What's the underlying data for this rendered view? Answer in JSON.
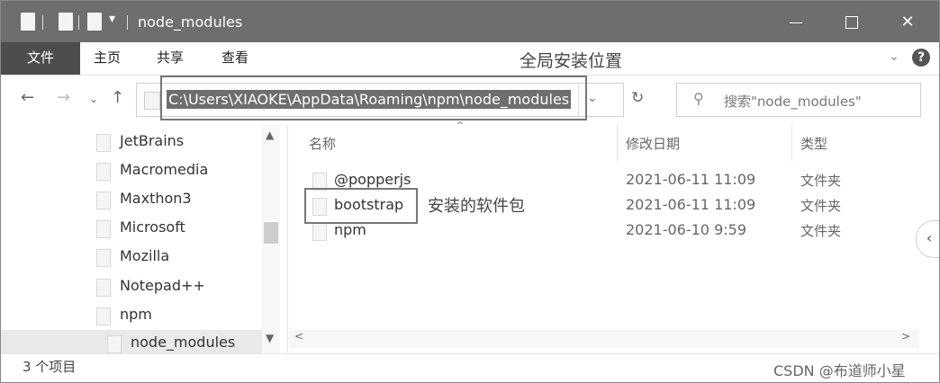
{
  "window": {
    "title": "node_modules",
    "quick_access_dropdown": "▾"
  },
  "ribbon": {
    "tabs": [
      "文件",
      "主页",
      "共享",
      "查看"
    ],
    "annotation": "全局安装位置",
    "help": "?"
  },
  "address": {
    "path": "C:\\Users\\XIAOKE\\AppData\\Roaming\\npm\\node_modules",
    "search_placeholder": "搜索\"node_modules\""
  },
  "navigation": {
    "items": [
      "JetBrains",
      "Macromedia",
      "Maxthon3",
      "Microsoft",
      "Mozilla",
      "Notepad++",
      "npm",
      "node_modules"
    ],
    "selected": "node_modules"
  },
  "file_list": {
    "columns": [
      "名称",
      "修改日期",
      "类型"
    ],
    "rows": [
      {
        "name": "@popperjs",
        "date": "2021-06-11 11:09",
        "type": "文件夹"
      },
      {
        "name": "bootstrap",
        "date": "2021-06-11 11:09",
        "type": "文件夹"
      },
      {
        "name": "npm",
        "date": "2021-06-10 9:59",
        "type": "文件夹"
      }
    ],
    "annotation": "安装的软件包"
  },
  "status": {
    "item_count": "3 个项目",
    "watermark": "CSDN @布道师小星"
  }
}
